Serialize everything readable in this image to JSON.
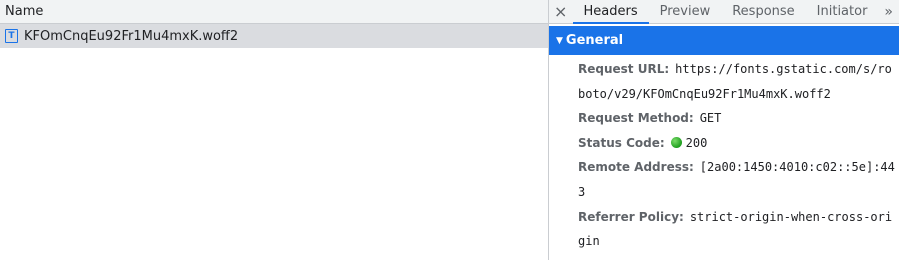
{
  "left": {
    "column_header": "Name",
    "request": {
      "icon_letter": "T",
      "name": "KFOmCnqEu92Fr1Mu4mxK.woff2"
    }
  },
  "tabs": {
    "close": "×",
    "items": [
      "Headers",
      "Preview",
      "Response",
      "Initiator"
    ],
    "active": "Headers",
    "more": "»"
  },
  "general": {
    "title": "General",
    "request_url_label": "Request URL:",
    "request_url": "https://fonts.gstatic.com/s/roboto/v29/KFOmCnqEu92Fr1Mu4mxK.woff2",
    "request_method_label": "Request Method:",
    "request_method": "GET",
    "status_code_label": "Status Code:",
    "status_code": "200",
    "status_color": "#1e9e1e",
    "remote_address_label": "Remote Address:",
    "remote_address": "[2a00:1450:4010:c02::5e]:443",
    "referrer_policy_label": "Referrer Policy:",
    "referrer_policy": "strict-origin-when-cross-origin"
  }
}
